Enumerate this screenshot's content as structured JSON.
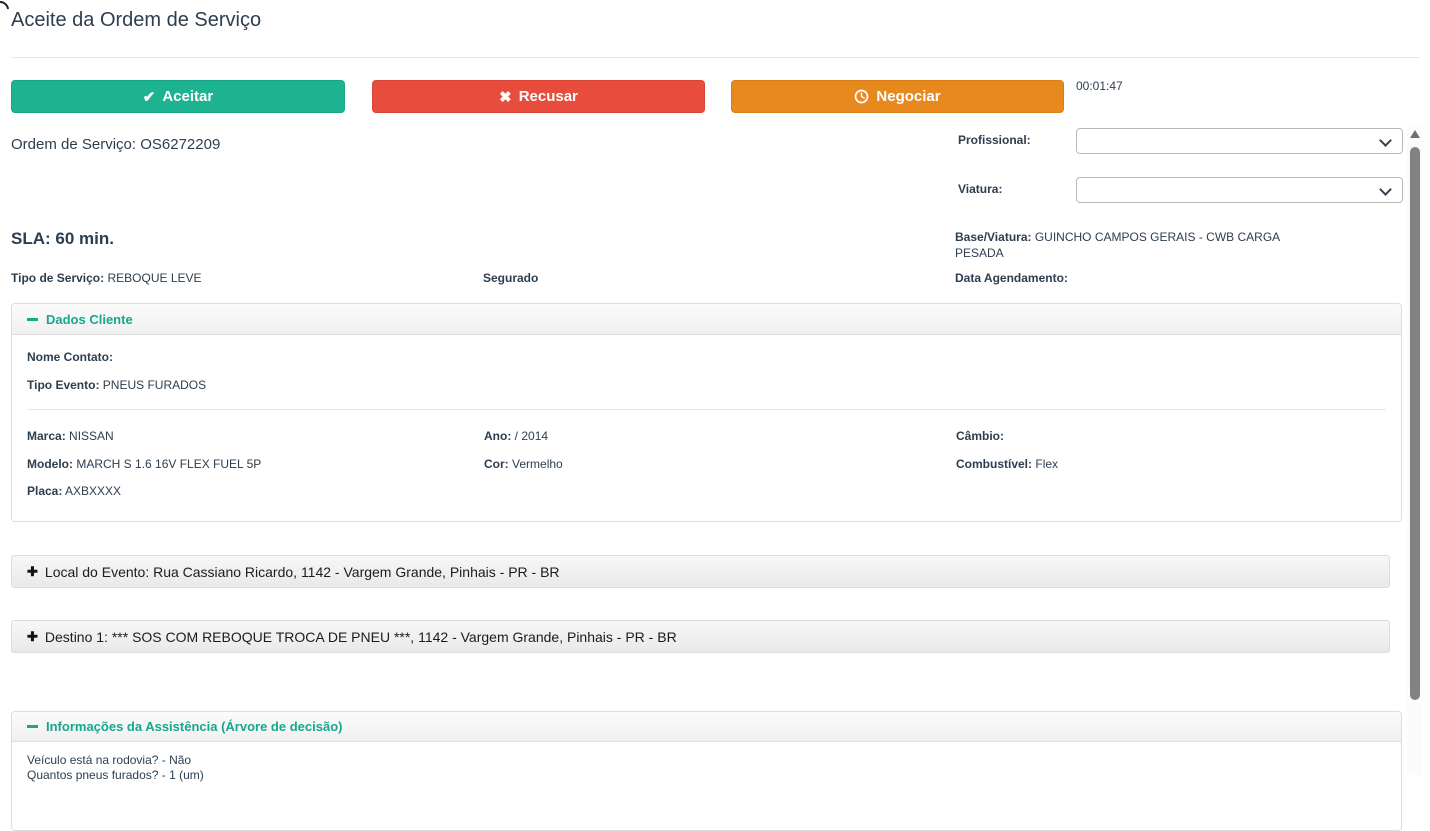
{
  "header": {
    "title": "Aceite da Ordem de Serviço"
  },
  "toolbar": {
    "accept_label": "Aceitar",
    "refuse_label": "Recusar",
    "negotiate_label": "Negociar",
    "timer": "00:01:47"
  },
  "icons": {
    "accept": "✔",
    "refuse": "✖",
    "plus": "✚"
  },
  "order": {
    "number_line": "Ordem de Serviço: OS6272209",
    "sla": "SLA: 60 min."
  },
  "assignment": {
    "profissional_label": "Profissional:",
    "profissional_value": "",
    "viatura_label": "Viatura:",
    "viatura_value": "",
    "base_viatura_label": "Base/Viatura:",
    "base_viatura_value": "GUINCHO CAMPOS GERAIS - CWB CARGA PESADA",
    "data_agendamento_label": "Data Agendamento:",
    "data_agendamento_value": ""
  },
  "service": {
    "tipo_servico_label": "Tipo de Serviço:",
    "tipo_servico_value": "REBOQUE LEVE",
    "segurado_label": "Segurado"
  },
  "dados_cliente": {
    "title": "Dados Cliente",
    "nome_contato_label": "Nome Contato:",
    "nome_contato_value": "",
    "tipo_evento_label": "Tipo Evento:",
    "tipo_evento_value": "PNEUS FURADOS",
    "marca_label": "Marca:",
    "marca_value": "NISSAN",
    "ano_label": "Ano:",
    "ano_value": "/ 2014",
    "cambio_label": "Câmbio:",
    "cambio_value": "",
    "modelo_label": "Modelo:",
    "modelo_value": "MARCH S 1.6 16V FLEX FUEL 5P",
    "cor_label": "Cor:",
    "cor_value": "Vermelho",
    "combustivel_label": "Combustível:",
    "combustivel_value": "Flex",
    "placa_label": "Placa:",
    "placa_value": "AXBXXXX"
  },
  "local_evento": {
    "text": "Local do Evento: Rua Cassiano Ricardo, 1142 - Vargem Grande, Pinhais - PR - BR"
  },
  "destino1": {
    "text": "Destino 1: *** SOS COM REBOQUE TROCA DE PNEU ***, 1142 - Vargem Grande, Pinhais - PR - BR"
  },
  "assistencia": {
    "title": "Informações da Assistência (Árvore de decisão)",
    "lines": [
      "Veículo está na rodovia? - Não",
      "Quantos pneus furados? - 1 (um)"
    ]
  },
  "colors": {
    "accent_teal": "#1db390",
    "accent_red": "#e74c3c",
    "accent_orange": "#e8891d",
    "section_title_teal": "#17a78c",
    "text_dark": "#2c3e50"
  }
}
